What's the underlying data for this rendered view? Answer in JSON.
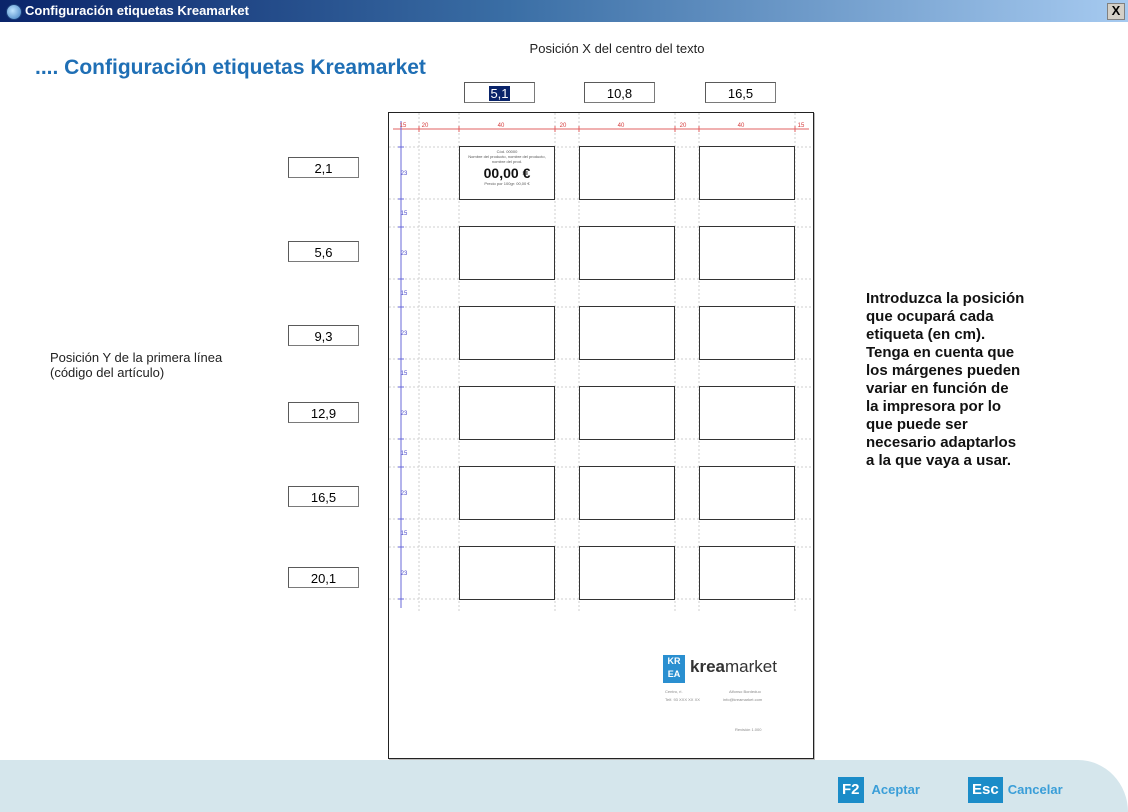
{
  "window": {
    "title": "Configuración etiquetas Kreamarket",
    "close_label": "X"
  },
  "page": {
    "heading": ".... Configuración etiquetas Kreamarket"
  },
  "x_positions": {
    "label": "Posición X del centro del texto",
    "values": [
      "5,1",
      "10,8",
      "16,5"
    ]
  },
  "y_positions": {
    "label_line1": "Posición Y de la primera línea",
    "label_line2": "(código del artículo)",
    "values": [
      "2,1",
      "5,6",
      "9,3",
      "12,9",
      "16,5",
      "20,1"
    ]
  },
  "sheet": {
    "top_ruler": [
      "15",
      "20",
      "40",
      "20",
      "40",
      "20",
      "40",
      "15"
    ],
    "side_ruler": [
      "23",
      "15",
      "23",
      "15",
      "23",
      "15",
      "23",
      "15",
      "23",
      "15",
      "23"
    ],
    "sample_label": {
      "code": "Cód. 00000",
      "name": "Nombre del producto, nombre del producto, nombre del prod.",
      "price": "00,00 €",
      "unit_price": "Precio por 100gr: 00,00 €"
    },
    "logo": {
      "mark_line1": "KR",
      "mark_line2": "EA",
      "brand_prefix": "krea",
      "brand_suffix": "market"
    },
    "footer_info": {
      "col1_line1": "Centro, ri.",
      "col1_line2": "Telf. 93 XXX XX XX",
      "col2_line1": "Alfonso Bordeduo",
      "col2_line2": "info@kreamarket.com",
      "version": "Revisión 1.000"
    }
  },
  "instructions": [
    "Introduzca la posición",
    "que ocupará  cada",
    "etiqueta (en cm).",
    "Tenga en cuenta que",
    "los márgenes pueden",
    "variar en función de",
    "la impresora por lo",
    "que puede ser",
    "necesario adaptarlos",
    "a la que vaya a usar."
  ],
  "buttons": {
    "accept": {
      "key": "F2",
      "label": "Aceptar"
    },
    "cancel": {
      "key": "Esc",
      "label": "Cancelar"
    }
  },
  "colors": {
    "accent": "#1b8cc8",
    "heading": "#1f6fb5",
    "footer": "#d5e6ec",
    "ruler_red": "#d43b3b",
    "ruler_blue": "#4a4ac8"
  }
}
